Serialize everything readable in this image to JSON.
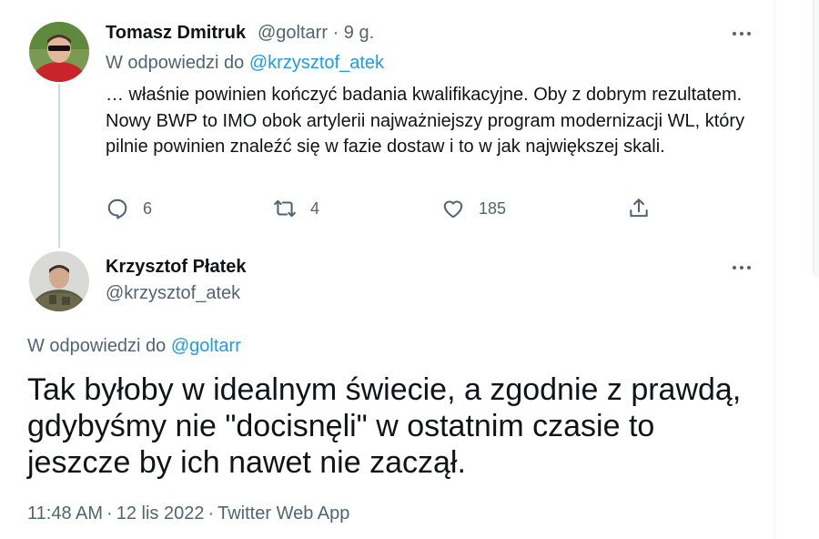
{
  "reply_tweet": {
    "author_name": "Tomasz Dmitruk",
    "handle": "@goltarr",
    "separator": "·",
    "time": "9 g.",
    "replying_prefix": "W odpowiedzi do",
    "replying_to": "@krzysztof_atek",
    "text": "… właśnie powinien kończyć badania kwalifikacyjne. Oby z dobrym rezultatem. Nowy BWP to IMO obok artylerii najważniejszy program modernizacji WL, który pilnie powinien znaleźć się w fazie dostaw i to w jak największej skali.",
    "actions": {
      "reply_count": "6",
      "retweet_count": "4",
      "like_count": "185"
    }
  },
  "main_tweet": {
    "author_name": "Krzysztof Płatek",
    "handle": "@krzysztof_atek",
    "replying_prefix": "W odpowiedzi do",
    "replying_to": "@goltarr",
    "text": "Tak byłoby w idealnym świecie, a zgodnie z prawdą, gdybyśmy nie \"docisnęli\" w ostatnim czasie to jeszcze by ich nawet nie zaczął.",
    "time": "11:48 AM",
    "date": "12 lis 2022",
    "source": "Twitter Web App",
    "separator": "·"
  },
  "colors": {
    "accent": "#1d9bf0",
    "muted": "#536471",
    "text": "#0f1419",
    "thread_line": "#cfd9de"
  },
  "icons": [
    "reply-icon",
    "retweet-icon",
    "like-icon",
    "share-icon",
    "more-icon"
  ]
}
